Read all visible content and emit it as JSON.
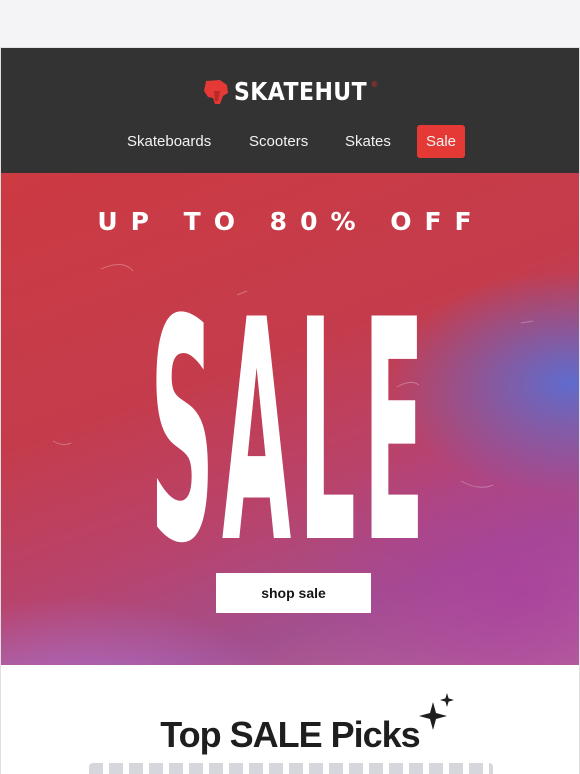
{
  "brand": {
    "name": "SKATEHUT",
    "registered_mark": "®",
    "logo_icon": "hand-print-logo-icon",
    "accent_color": "#e53935"
  },
  "nav": {
    "items": [
      {
        "label": "Skateboards"
      },
      {
        "label": "Scooters"
      },
      {
        "label": "Skates"
      },
      {
        "label": "Sale",
        "highlighted": true
      }
    ]
  },
  "hero": {
    "headline": "UP TO 80% OFF",
    "title": "SALE",
    "cta_label": "shop sale"
  },
  "picks": {
    "title": "Top SALE Picks",
    "sparkle_icon": "sparkle-icon"
  },
  "colors": {
    "header_bg": "#333333",
    "hero_red": "#cc3a42",
    "hero_purple": "#a34f8e"
  }
}
